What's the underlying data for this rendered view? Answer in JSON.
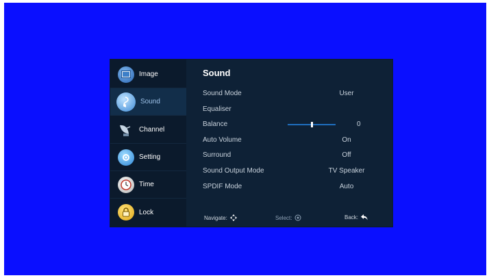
{
  "sidebar": {
    "items": [
      {
        "label": "Image",
        "icon": "image-icon"
      },
      {
        "label": "Sound",
        "icon": "sound-icon"
      },
      {
        "label": "Channel",
        "icon": "satellite-dish-icon"
      },
      {
        "label": "Setting",
        "icon": "setting-icon"
      },
      {
        "label": "Time",
        "icon": "clock-icon"
      },
      {
        "label": "Lock",
        "icon": "padlock-icon"
      }
    ],
    "active_index": 1
  },
  "panel": {
    "title": "Sound",
    "rows": [
      {
        "label": "Sound Mode",
        "value": "User"
      },
      {
        "label": "Equaliser",
        "value": ""
      },
      {
        "label": "Balance",
        "value": "0",
        "slider_level": 0.5
      },
      {
        "label": "Auto Volume",
        "value": "On"
      },
      {
        "label": "Surround",
        "value": "Off"
      },
      {
        "label": "Sound Output Mode",
        "value": "TV Speaker"
      },
      {
        "label": "SPDIF Mode",
        "value": "Auto"
      }
    ]
  },
  "footer": {
    "navigate": "Navigate:",
    "select": "Select:",
    "back": "Back:"
  },
  "colors": {
    "background": "#0a0fff",
    "menu_bg": "#0e2136",
    "sidebar_bg": "#0b1a2c",
    "accent": "#1f6fbf"
  }
}
